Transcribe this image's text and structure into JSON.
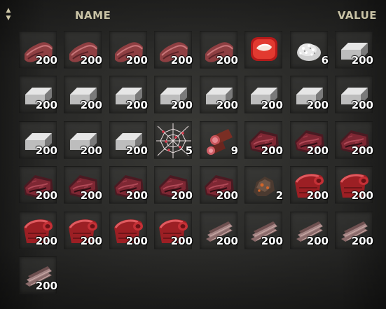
{
  "header": {
    "sort_up": "▲",
    "sort_down": "▼",
    "name_label": "NAME",
    "value_label": "VALUE"
  },
  "items": [
    {
      "icon": "red-fabric-icon",
      "qty": "200"
    },
    {
      "icon": "red-fabric-icon",
      "qty": "200"
    },
    {
      "icon": "red-fabric-icon",
      "qty": "200"
    },
    {
      "icon": "red-fabric-icon",
      "qty": "200"
    },
    {
      "icon": "red-fabric-icon",
      "qty": "200"
    },
    {
      "icon": "red-gem-icon",
      "qty": ""
    },
    {
      "icon": "white-powder-icon",
      "qty": "6"
    },
    {
      "icon": "silver-ingot-icon",
      "qty": "200"
    },
    {
      "icon": "silver-ingot-icon",
      "qty": "200"
    },
    {
      "icon": "silver-ingot-icon",
      "qty": "200"
    },
    {
      "icon": "silver-ingot-icon",
      "qty": "200"
    },
    {
      "icon": "silver-ingot-icon",
      "qty": "200"
    },
    {
      "icon": "silver-ingot-icon",
      "qty": "200"
    },
    {
      "icon": "silver-ingot-icon",
      "qty": "200"
    },
    {
      "icon": "silver-ingot-icon",
      "qty": "200"
    },
    {
      "icon": "silver-ingot-icon",
      "qty": "200"
    },
    {
      "icon": "silver-ingot-icon",
      "qty": "200"
    },
    {
      "icon": "silver-ingot-icon",
      "qty": "200"
    },
    {
      "icon": "silver-ingot-icon",
      "qty": "200"
    },
    {
      "icon": "spider-web-icon",
      "qty": "5"
    },
    {
      "icon": "wood-log-icon",
      "qty": "9"
    },
    {
      "icon": "dark-red-leather-icon",
      "qty": "200"
    },
    {
      "icon": "dark-red-leather-icon",
      "qty": "200"
    },
    {
      "icon": "dark-red-leather-icon",
      "qty": "200"
    },
    {
      "icon": "dark-red-leather-icon",
      "qty": "200"
    },
    {
      "icon": "dark-red-leather-icon",
      "qty": "200"
    },
    {
      "icon": "dark-red-leather-icon",
      "qty": "200"
    },
    {
      "icon": "dark-red-leather-icon",
      "qty": "200"
    },
    {
      "icon": "dark-red-leather-icon",
      "qty": "200"
    },
    {
      "icon": "ore-rock-icon",
      "qty": "2"
    },
    {
      "icon": "red-cloth-roll-icon",
      "qty": "200"
    },
    {
      "icon": "red-cloth-roll-icon",
      "qty": "200"
    },
    {
      "icon": "red-cloth-roll-icon",
      "qty": "200"
    },
    {
      "icon": "red-cloth-roll-icon",
      "qty": "200"
    },
    {
      "icon": "red-cloth-roll-icon",
      "qty": "200"
    },
    {
      "icon": "red-cloth-roll-icon",
      "qty": "200"
    },
    {
      "icon": "wood-planks-icon",
      "qty": "200"
    },
    {
      "icon": "wood-planks-icon",
      "qty": "200"
    },
    {
      "icon": "wood-planks-icon",
      "qty": "200"
    },
    {
      "icon": "wood-planks-icon",
      "qty": "200"
    },
    {
      "icon": "wood-planks-icon",
      "qty": "200"
    }
  ]
}
